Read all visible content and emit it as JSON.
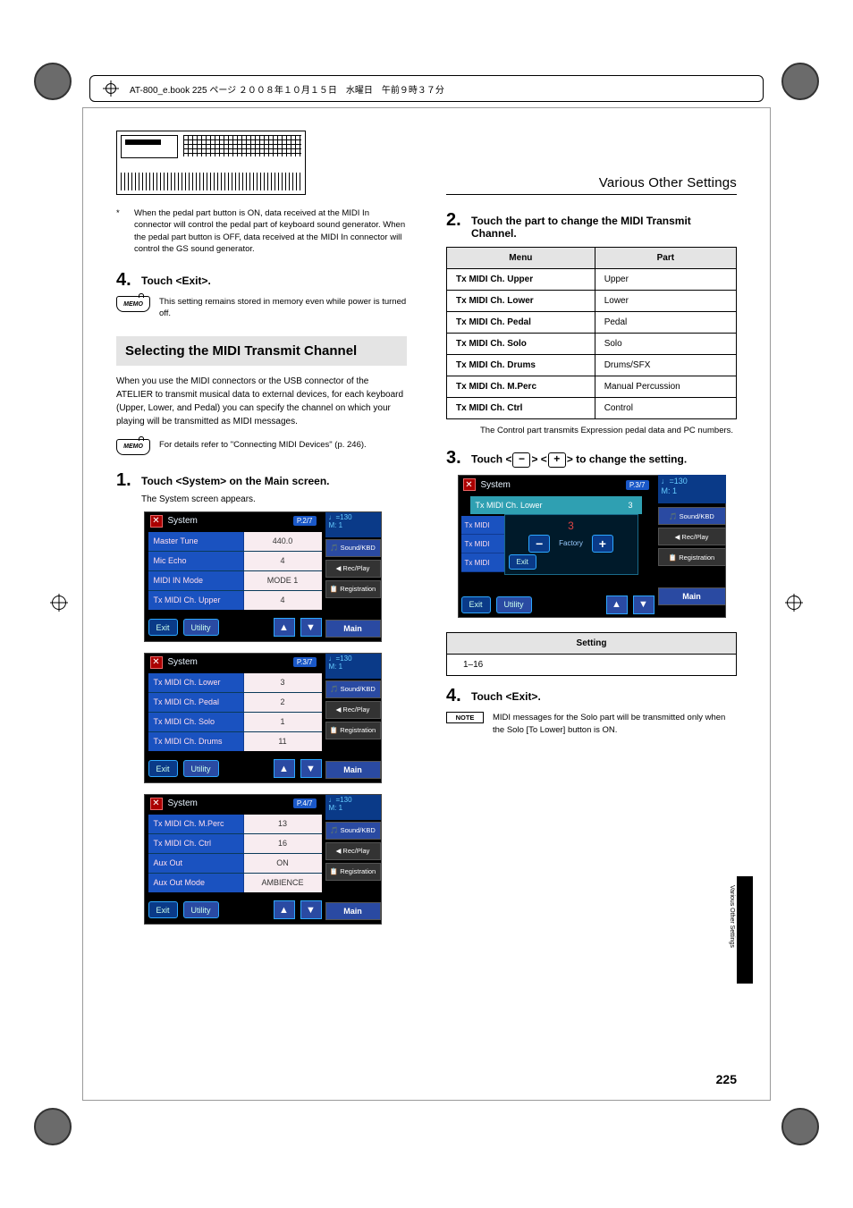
{
  "crop_header_text": "AT-800_e.book  225 ページ  ２００８年１０月１５日　水曜日　午前９時３７分",
  "left": {
    "footnote_ast": "*",
    "footnote": "When the pedal part button is ON, data received at the MIDI In connector will control the pedal part of keyboard sound generator. When the pedal part button is OFF, data received at the MIDI In connector will control the GS sound generator.",
    "step4_num": "4.",
    "step4_text": "Touch <Exit>.",
    "memo_label": "MEMO",
    "memo_text": "This setting remains stored in memory even while power is turned off.",
    "subsection": "Selecting the MIDI Transmit Channel",
    "subsection_para": "When you use the MIDI connectors or the USB connector of the ATELIER to transmit musical data to external devices, for each keyboard (Upper, Lower, and Pedal) you can specify the channel on which your playing will be transmitted as MIDI messages.",
    "memo2_text": "For details refer to \"Connecting MIDI Devices\" (p. 246).",
    "step1_num": "1.",
    "step1_text": "Touch <System> on the Main screen.",
    "step1_sub": "The System screen appears.",
    "ss1": {
      "title": "System",
      "page": "P.2/7",
      "tempo": "♩=130",
      "meter": "M:    1",
      "rows": [
        {
          "label": "Master Tune",
          "val": "440.0"
        },
        {
          "label": "Mic Echo",
          "val": "4"
        },
        {
          "label": "MIDI IN Mode",
          "val": "MODE 1"
        },
        {
          "label": "Tx MIDI Ch. Upper",
          "val": "4"
        }
      ],
      "exit": "Exit",
      "utility": "Utility",
      "tabs": {
        "sound": "🎵 Sound/KBD",
        "rec": "◀ Rec/Play",
        "reg": "📋 Registration",
        "main": "Main"
      }
    },
    "ss2": {
      "title": "System",
      "page": "P.3/7",
      "tempo": "♩=130",
      "meter": "M:    1",
      "rows": [
        {
          "label": "Tx MIDI Ch. Lower",
          "val": "3"
        },
        {
          "label": "Tx MIDI Ch. Pedal",
          "val": "2"
        },
        {
          "label": "Tx MIDI Ch. Solo",
          "val": "1"
        },
        {
          "label": "Tx MIDI Ch. Drums",
          "val": "11"
        }
      ],
      "exit": "Exit",
      "utility": "Utility",
      "tabs": {
        "sound": "🎵 Sound/KBD",
        "rec": "◀ Rec/Play",
        "reg": "📋 Registration",
        "main": "Main"
      }
    },
    "ss3": {
      "title": "System",
      "page": "P.4/7",
      "tempo": "♩=130",
      "meter": "M:    1",
      "rows": [
        {
          "label": "Tx MIDI Ch. M.Perc",
          "val": "13"
        },
        {
          "label": "Tx MIDI Ch. Ctrl",
          "val": "16"
        },
        {
          "label": "Aux Out",
          "val": "ON"
        },
        {
          "label": "Aux Out Mode",
          "val": "AMBIENCE"
        }
      ],
      "exit": "Exit",
      "utility": "Utility",
      "tabs": {
        "sound": "🎵 Sound/KBD",
        "rec": "◀ Rec/Play",
        "reg": "📋 Registration",
        "main": "Main"
      }
    }
  },
  "right": {
    "header": "Various Other Settings",
    "step2_num": "2.",
    "step2_text": "Touch the part to change the MIDI Transmit Channel.",
    "table_head": {
      "menu": "Menu",
      "part": "Part"
    },
    "table_rows": [
      {
        "menu": "Tx MIDI Ch. Upper",
        "part": "Upper"
      },
      {
        "menu": "Tx MIDI Ch. Lower",
        "part": "Lower"
      },
      {
        "menu": "Tx MIDI Ch. Pedal",
        "part": "Pedal"
      },
      {
        "menu": "Tx MIDI Ch. Solo",
        "part": "Solo"
      },
      {
        "menu": "Tx MIDI Ch. Drums",
        "part": "Drums/SFX"
      },
      {
        "menu": "Tx MIDI Ch. M.Perc",
        "part": "Manual Percussion"
      },
      {
        "menu": "Tx MIDI Ch. Ctrl",
        "part": "Control"
      }
    ],
    "table_note": "The Control part transmits Expression pedal data and PC numbers.",
    "step3_num": "3.",
    "step3_pre": "Touch <",
    "step3_mid": "> <",
    "step3_post": "> to change the setting.",
    "minus": "−",
    "plus": "+",
    "popup": {
      "title": "System",
      "page": "P.3/7",
      "tempo": "♩=130",
      "meter": "M:    1",
      "bar_label": "Tx MIDI Ch. Lower",
      "bar_val": "3",
      "inner_val": "3",
      "factory": "Factory",
      "exit_inner": "Exit",
      "side": [
        "Tx MIDI",
        "Tx MIDI",
        "Tx MIDI"
      ],
      "exit": "Exit",
      "utility": "Utility",
      "tabs": {
        "sound": "🎵 Sound/KBD",
        "rec": "◀ Rec/Play",
        "reg": "📋 Registration",
        "main": "Main"
      }
    },
    "setting_head": "Setting",
    "setting_val": "1–16",
    "step4_num": "4.",
    "step4_text": "Touch <Exit>.",
    "note_label": "NOTE",
    "note_text": "MIDI messages for the Solo part will be transmitted only when the Solo [To Lower] button is ON.",
    "side_tab_text": "Various Other Settings",
    "page_num": "225"
  }
}
